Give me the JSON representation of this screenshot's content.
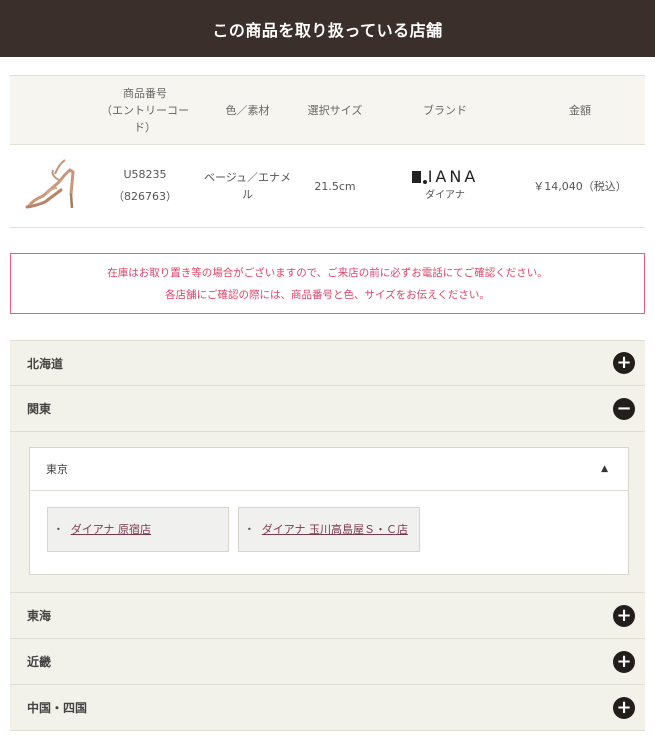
{
  "header": {
    "title": "この商品を取り扱っている店舗"
  },
  "product_table": {
    "headers": [
      "商品番号\n（エントリーコード）",
      "色／素材",
      "選択サイズ",
      "ブランド",
      "金額"
    ],
    "header_product_no": "商品番号",
    "header_entry_code_1": "（エントリーコー",
    "header_entry_code_2": "ド）",
    "header_color": "色／素材",
    "header_size": "選択サイズ",
    "header_brand": "ブランド",
    "header_price": "金額",
    "row": {
      "product_no": "U58235",
      "entry_code": "（826763）",
      "color": "ベージュ／エナメル",
      "size": "21.5cm",
      "brand_logo_text": "IANA",
      "brand_name": "ダイアナ",
      "price": "￥14,040（税込）",
      "image_icon": "sandal-image"
    }
  },
  "notice": {
    "line1": "在庫はお取り置き等の場合がございますので、ご来店の前に必ずお電話にてご確認ください。",
    "line2": "各店舗にご確認の際には、商品番号と色、サイズをお伝えください。"
  },
  "regions": [
    {
      "name": "北海道",
      "state": "collapsed",
      "icon": "plus-icon"
    },
    {
      "name": "関東",
      "state": "expanded",
      "icon": "minus-icon"
    },
    {
      "name": "東海",
      "state": "collapsed",
      "icon": "plus-icon"
    },
    {
      "name": "近畿",
      "state": "collapsed",
      "icon": "plus-icon"
    },
    {
      "name": "中国・四国",
      "state": "collapsed",
      "icon": "plus-icon"
    }
  ],
  "kanto": {
    "prefecture": "東京",
    "stores": [
      "ダイアナ 原宿店",
      "ダイアナ 玉川高島屋Ｓ・Ｃ店"
    ]
  },
  "colors": {
    "header_bg": "#3a2f2b",
    "notice_border": "#e6607c",
    "notice_text": "#e0436a",
    "accordion_bg": "#f3f2ea",
    "link": "#7a3a4a"
  }
}
